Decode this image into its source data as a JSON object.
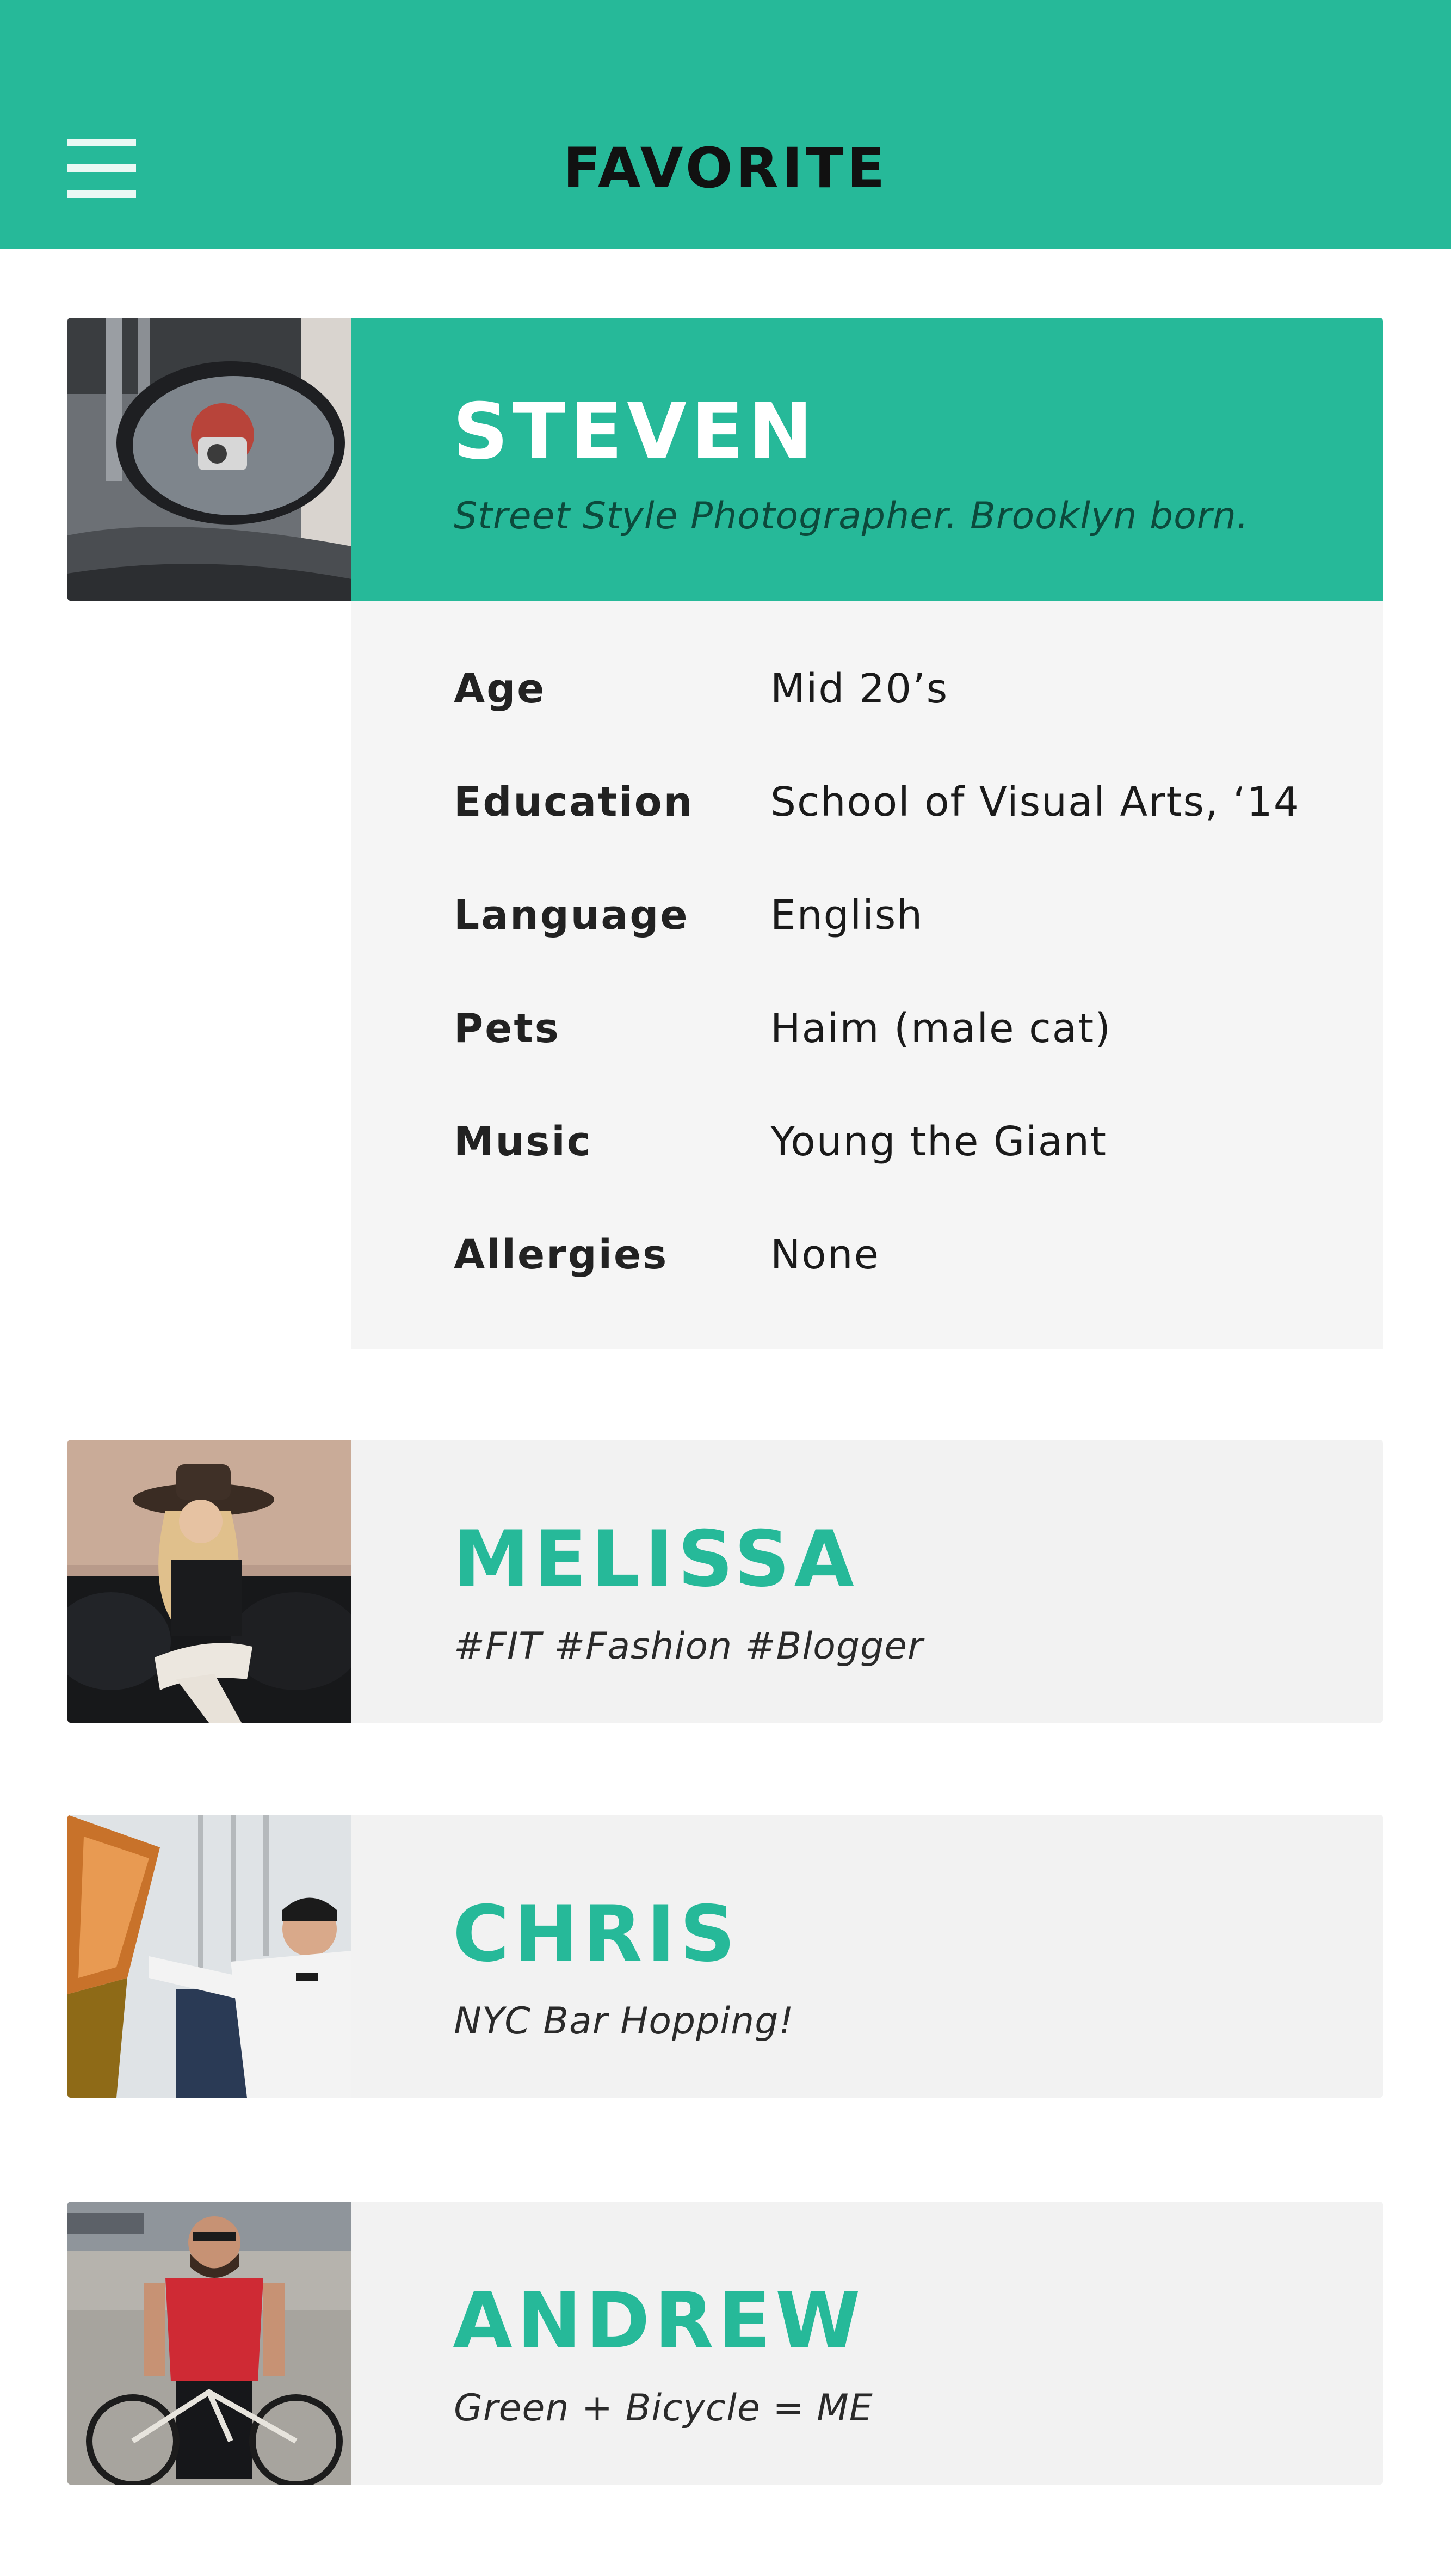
{
  "header": {
    "title": "FAVORITE",
    "menu_icon": "hamburger-menu-icon",
    "background": "#26b999"
  },
  "theme": {
    "accent": "#26b999",
    "card_background": "#f2f2f2",
    "details_background": "#f5f5f5"
  },
  "profiles": [
    {
      "name": "STEVEN",
      "tagline": "Street Style Photographer. Brooklyn born.",
      "expanded": true,
      "details": [
        {
          "label": "Age",
          "value": "Mid 20’s"
        },
        {
          "label": "Education",
          "value": "School of Visual Arts, ‘14"
        },
        {
          "label": "Language",
          "value": "English"
        },
        {
          "label": "Pets",
          "value": "Haim (male cat)"
        },
        {
          "label": "Music",
          "value": "Young the Giant"
        },
        {
          "label": "Allergies",
          "value": "None"
        }
      ]
    },
    {
      "name": "MELISSA",
      "tagline": "#FIT #Fashion #Blogger",
      "expanded": false
    },
    {
      "name": "CHRIS",
      "tagline": "NYC Bar Hopping!",
      "expanded": false
    },
    {
      "name": "ANDREW",
      "tagline": "Green + Bicycle = ME",
      "expanded": false
    }
  ]
}
